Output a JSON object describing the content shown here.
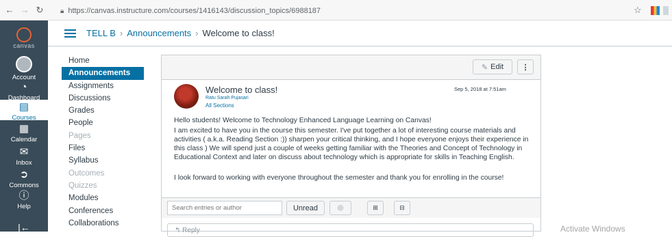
{
  "browser": {
    "url": "https://canvas.instructure.com/courses/1416143/discussion_topics/6988187"
  },
  "global_nav": {
    "logo_text": "canvas",
    "items": [
      {
        "label": "Account",
        "icon": "avatar-icon"
      },
      {
        "label": "Dashboard",
        "icon": "dashboard-icon"
      },
      {
        "label": "Courses",
        "icon": "courses-icon"
      },
      {
        "label": "Calendar",
        "icon": "calendar-icon"
      },
      {
        "label": "Inbox",
        "icon": "inbox-icon"
      },
      {
        "label": "Commons",
        "icon": "commons-icon"
      },
      {
        "label": "Help",
        "icon": "help-icon"
      }
    ],
    "bg_color": "#394b58"
  },
  "header": {
    "breadcrumb": [
      "TELL B",
      "Announcements",
      "Welcome to class!"
    ]
  },
  "course_nav": {
    "items": [
      {
        "label": "Home"
      },
      {
        "label": "Announcements"
      },
      {
        "label": "Assignments"
      },
      {
        "label": "Discussions"
      },
      {
        "label": "Grades"
      },
      {
        "label": "People"
      },
      {
        "label": "Pages"
      },
      {
        "label": "Files"
      },
      {
        "label": "Syllabus"
      },
      {
        "label": "Outcomes"
      },
      {
        "label": "Quizzes"
      },
      {
        "label": "Modules"
      },
      {
        "label": "Conferences"
      },
      {
        "label": "Collaborations"
      }
    ],
    "active_color": "#0770a3"
  },
  "discussion": {
    "edit_label": "Edit",
    "more_label": "⋮",
    "title": "Welcome to class!",
    "author": "Ratu Sarah Pujasari",
    "sections": "All Sections",
    "date": "Sep 5, 2018 at 7:51am",
    "paragraphs": [
      "Hello students! Welcome to Technology Enhanced Language Learning on Canvas!",
      "I am excited to have you in the course this semester. I've put together a lot of interesting course materials and activities ( a.k.a. Reading Section :)) sharpen your critical thinking, and I hope everyone enjoys their experience in this class ) We will spend just a couple of weeks getting familiar with the Theories and Concept of Technology in Educational Context and later on discuss about technology which is appropriate for skills in Teaching English.",
      "I look forward to working with everyone throughout the semester and thank you for enrolling in the course!"
    ],
    "search_placeholder": "Search entries or author",
    "unread_label": "Unread",
    "reply_label": "Reply"
  },
  "watermark": "Activate Windows"
}
